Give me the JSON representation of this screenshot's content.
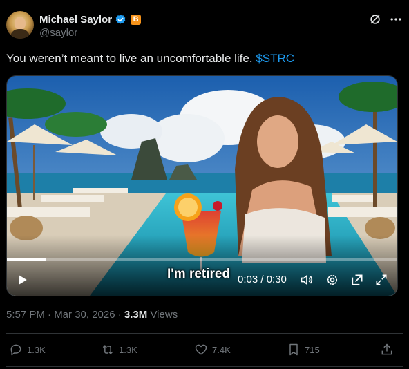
{
  "author": {
    "display_name": "Michael Saylor",
    "handle": "@saylor",
    "badge_text": "B",
    "verified_color": "#1d9bf0",
    "badge_color": "#f7931a"
  },
  "tweet": {
    "text": "You weren’t meant to live an uncomfortable life. ",
    "cashtag": "$STRC"
  },
  "video": {
    "caption": "I'm retired",
    "time": "0:03 / 0:30",
    "progress": 0.1
  },
  "meta": {
    "timestamp": "5:57 PM · Mar 30, 2026 · ",
    "views_count": "3.3M",
    "views_label": " Views"
  },
  "actions": {
    "replies": "1.3K",
    "reposts": "1.3K",
    "likes": "7.4K",
    "bookmarks": "715"
  },
  "icons": [
    "verified-icon",
    "grok-icon",
    "more-icon",
    "play-icon",
    "volume-icon",
    "settings-icon",
    "popout-icon",
    "fullscreen-icon",
    "reply-icon",
    "repost-icon",
    "like-icon",
    "bookmark-icon",
    "share-icon"
  ]
}
